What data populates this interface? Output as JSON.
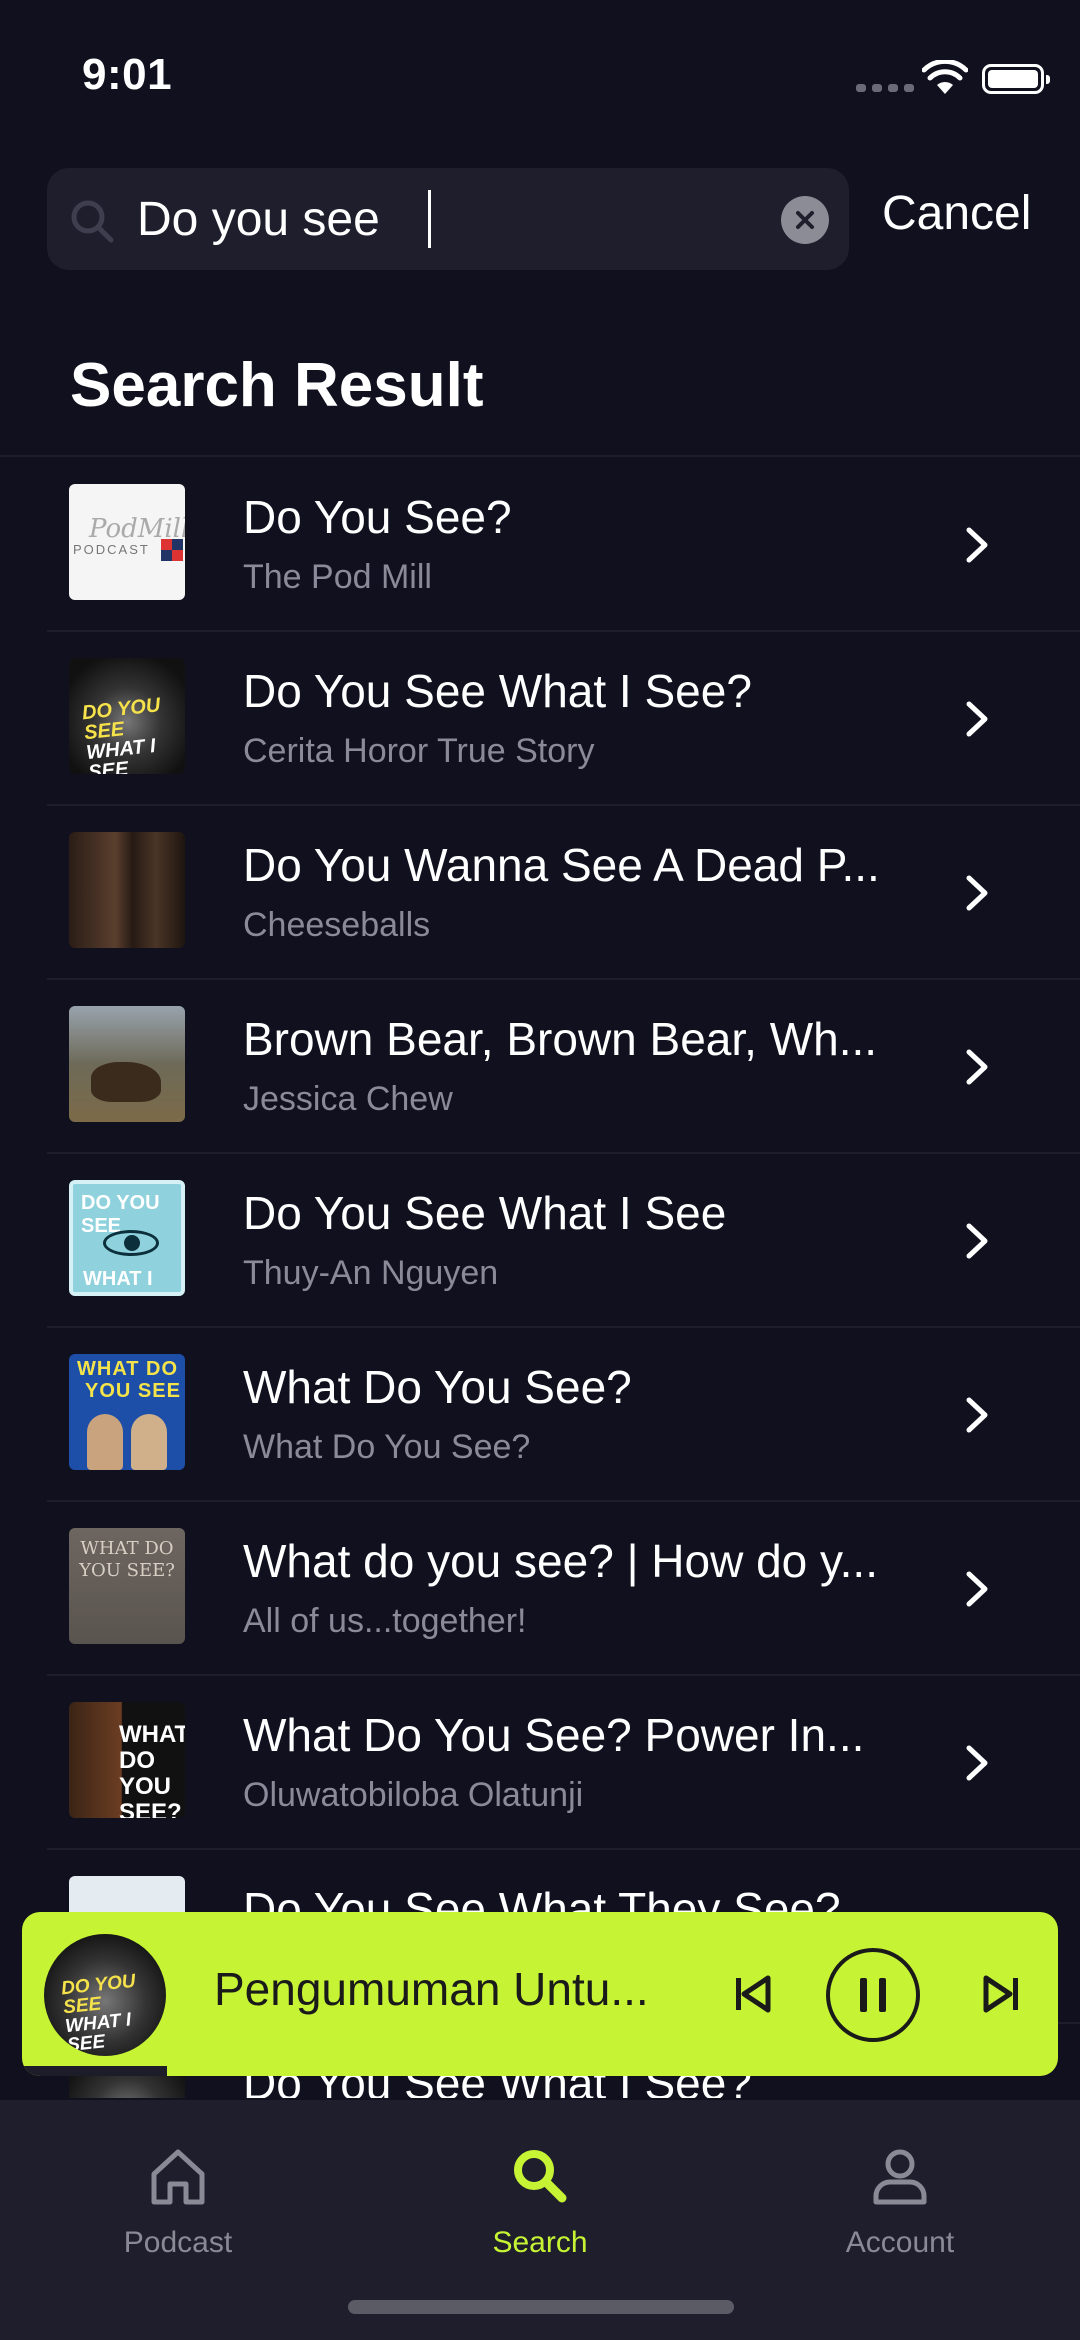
{
  "status_bar": {
    "time": "9:01"
  },
  "search": {
    "value": "Do you see",
    "cancel_label": "Cancel"
  },
  "section_title": "Search Result",
  "results": [
    {
      "title": "Do You See?",
      "subtitle": "The Pod Mill"
    },
    {
      "title": "Do You See What I See?",
      "subtitle": "Cerita Horor True Story"
    },
    {
      "title": "Do You Wanna See A Dead P...",
      "subtitle": "Cheeseballs"
    },
    {
      "title": "Brown Bear, Brown Bear, Wh...",
      "subtitle": "Jessica Chew"
    },
    {
      "title": "Do You See What I See",
      "subtitle": "Thuy-An Nguyen"
    },
    {
      "title": "What Do You See?",
      "subtitle": "What Do You See?"
    },
    {
      "title": "What do you see? | How do y...",
      "subtitle": "All of us...together!"
    },
    {
      "title": "What Do You See? Power In...",
      "subtitle": "Oluwatobiloba Olatunji"
    },
    {
      "title": "Do You See What They See?",
      "subtitle": ""
    },
    {
      "title": "Do You See What I See?",
      "subtitle": ""
    }
  ],
  "thumb_text": {
    "podmill_logo": "PODCAST",
    "podmill_script": "PodMill",
    "horror_line1": "DO YOU SEE",
    "horror_line2": "WHAT I SEE",
    "eye_line1": "DO YOU SEE",
    "eye_line2": "WHAT I SEE",
    "wdys_line1": "WHAT DO",
    "wdys_line2": "YOU SEE",
    "how_line": "WHAT DO YOU SEE?",
    "power_line": "WHAT DO YOU SEE?"
  },
  "player": {
    "title": "Pengumuman Untu...",
    "art_line1": "DO YOU SEE",
    "art_line2": "WHAT I SEE",
    "progress": 0.14,
    "accent": "#c6f434"
  },
  "tabs": [
    {
      "label": "Podcast",
      "icon": "home-icon",
      "active": false
    },
    {
      "label": "Search",
      "icon": "search-icon",
      "active": true
    },
    {
      "label": "Account",
      "icon": "person-icon",
      "active": false
    }
  ]
}
